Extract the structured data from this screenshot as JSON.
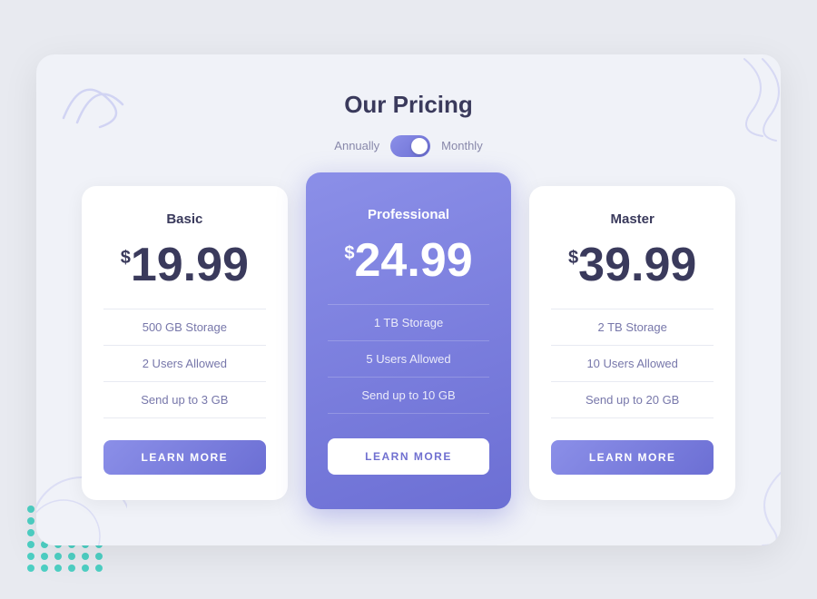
{
  "page": {
    "title": "Our Pricing",
    "toggle": {
      "left_label": "Annually",
      "right_label": "Monthly"
    },
    "plans": [
      {
        "id": "basic",
        "name": "Basic",
        "price_symbol": "$",
        "price": "19.99",
        "features": [
          "500 GB Storage",
          "2 Users Allowed",
          "Send up to 3 GB"
        ],
        "button_label": "LEARN MORE",
        "featured": false
      },
      {
        "id": "professional",
        "name": "Professional",
        "price_symbol": "$",
        "price": "24.99",
        "features": [
          "1 TB Storage",
          "5 Users Allowed",
          "Send up to 10 GB"
        ],
        "button_label": "LEARN MORE",
        "featured": true
      },
      {
        "id": "master",
        "name": "Master",
        "price_symbol": "$",
        "price": "39.99",
        "features": [
          "2 TB Storage",
          "10 Users Allowed",
          "Send up to 20 GB"
        ],
        "button_label": "LEARN MORE",
        "featured": false
      }
    ]
  },
  "dots": 36
}
